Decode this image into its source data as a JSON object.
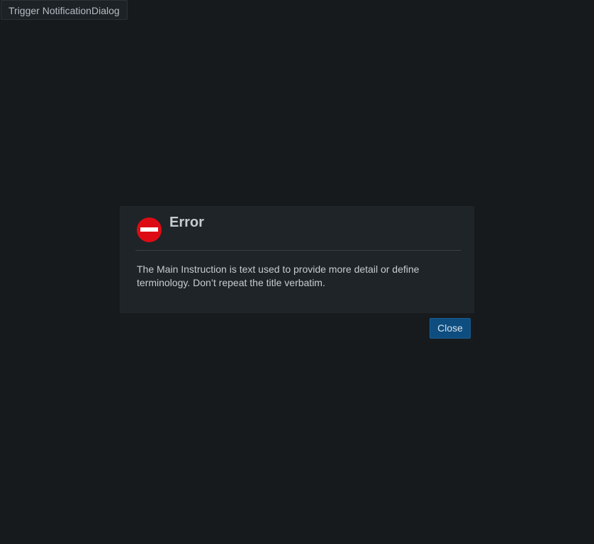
{
  "page": {
    "trigger_label": "Trigger NotificationDialog"
  },
  "dialog": {
    "title": "Error",
    "icon": "error-stop-icon",
    "message": "The Main Instruction is text used to provide more detail or define terminology. Don’t repeat the title verbatim.",
    "close_label": "Close"
  },
  "colors": {
    "page_background": "#161a1d",
    "dialog_background": "#1f2428",
    "error_icon": "#dd0c14",
    "primary_button": "#0d4d80"
  }
}
